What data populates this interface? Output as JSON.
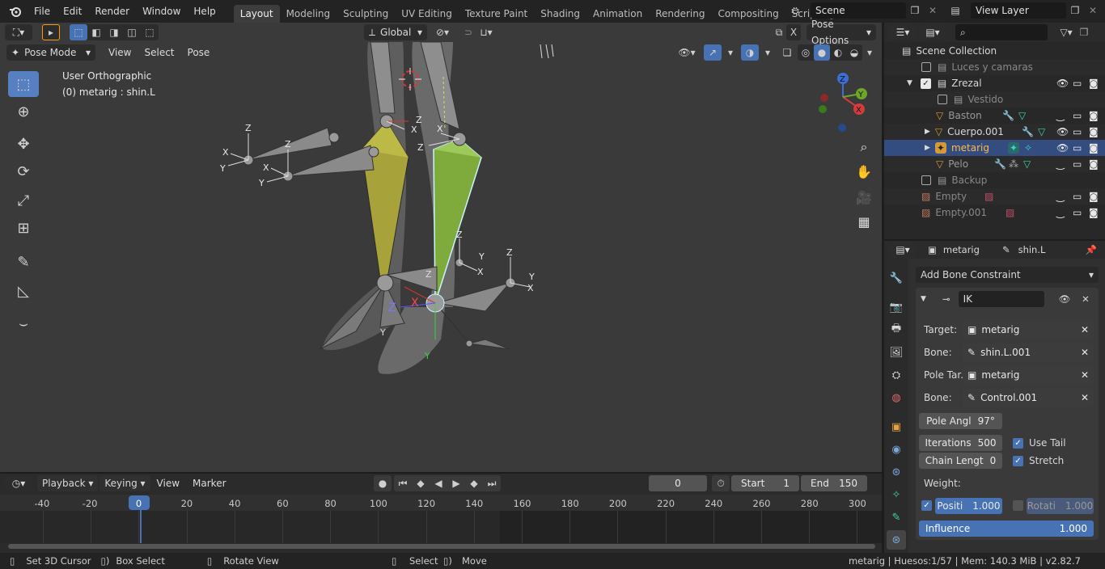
{
  "topbar": {
    "menus": [
      "File",
      "Edit",
      "Render",
      "Window",
      "Help"
    ],
    "workspaces": [
      "Layout",
      "Modeling",
      "Sculpting",
      "UV Editing",
      "Texture Paint",
      "Shading",
      "Animation",
      "Rendering",
      "Compositing",
      "Scripting"
    ],
    "active_workspace": "Layout",
    "add_tab": "+",
    "scene": "Scene",
    "view_layer": "View Layer"
  },
  "viewport": {
    "transform_orientation": "Global",
    "pose_options": "Pose Options",
    "mode": "Pose Mode",
    "menus": [
      "View",
      "Select",
      "Pose"
    ],
    "view_name": "User Orthographic",
    "active_info": "(0) metarig : shin.L",
    "x_toggle": "X",
    "axis_labels": {
      "z": "Z",
      "y": "Y",
      "x": "X"
    }
  },
  "timeline": {
    "menus": [
      "Playback",
      "Keying",
      "View",
      "Marker"
    ],
    "current_frame": "0",
    "start_label": "Start",
    "start_value": "1",
    "end_label": "End",
    "end_value": "150",
    "ticks": [
      "-40",
      "-20",
      "0",
      "20",
      "40",
      "60",
      "80",
      "100",
      "120",
      "140",
      "160",
      "180",
      "200",
      "220",
      "240",
      "260",
      "280",
      "300"
    ]
  },
  "statusbar": {
    "set_cursor": "Set 3D Cursor",
    "box_select": "Box Select",
    "rotate_view": "Rotate View",
    "select": "Select",
    "move": "Move",
    "info": "metarig | Huesos:1/57 | Mem: 140.3 MiB | v2.82.7"
  },
  "outliner": {
    "root": "Scene Collection",
    "items": [
      {
        "label": "Luces y camaras",
        "dim": true
      },
      {
        "label": "Zrezal",
        "dim": false
      },
      {
        "label": "Vestido",
        "dim": true
      },
      {
        "label": "Baston",
        "dim": true
      },
      {
        "label": "Cuerpo.001",
        "dim": false
      },
      {
        "label": "metarig",
        "dim": false
      },
      {
        "label": "Pelo",
        "dim": true
      },
      {
        "label": "Backup",
        "dim": true
      },
      {
        "label": "Empty",
        "dim": true
      },
      {
        "label": "Empty.001",
        "dim": true
      }
    ]
  },
  "properties": {
    "breadcrumb_object": "metarig",
    "breadcrumb_bone": "shin.L",
    "add_constraint": "Add Bone Constraint",
    "constraint_name": "IK",
    "target_label": "Target:",
    "target_value": "metarig",
    "bone_label": "Bone:",
    "bone_value": "shin.L.001",
    "pole_target_label": "Pole Tar..",
    "pole_target_value": "metarig",
    "pole_bone_label": "Bone:",
    "pole_bone_value": "Control.001",
    "pole_angle_label": "Pole Angl",
    "pole_angle_value": "97°",
    "iterations_label": "Iterations",
    "iterations_value": "500",
    "use_tail_label": "Use Tail",
    "chain_length_label": "Chain Lengt",
    "chain_length_value": "0",
    "stretch_label": "Stretch",
    "weight_label": "Weight:",
    "position_label": "Positi",
    "position_value": "1.000",
    "rotation_label": "Rotati",
    "rotation_value": "1.000",
    "influence_label": "Influence",
    "influence_value": "1.000"
  },
  "colors": {
    "accent": "#4772b3",
    "selected_row": "#334d80",
    "viewport_bg": "#3a3a3a",
    "active_bone": "#7faa3c",
    "selected_bone": "#a7a33a"
  }
}
